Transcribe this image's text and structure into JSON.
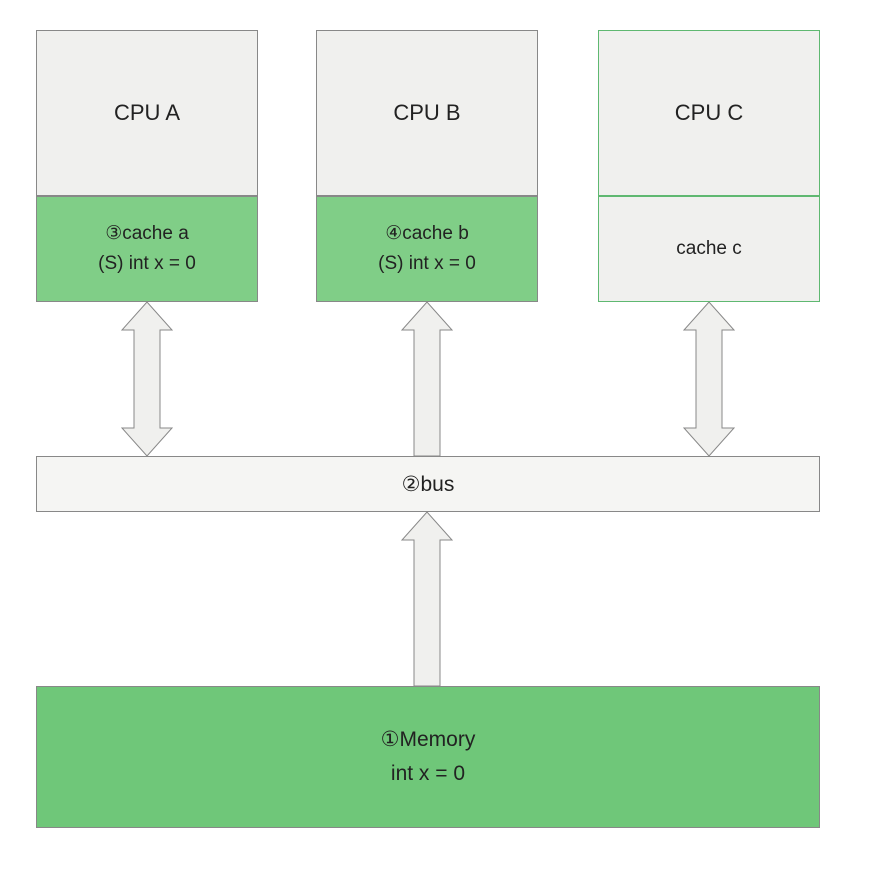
{
  "cpu_a": {
    "label": "CPU A"
  },
  "cpu_b": {
    "label": "CPU B"
  },
  "cpu_c": {
    "label": "CPU C"
  },
  "cache_a": {
    "title": "③cache a",
    "content": "(S) int x = 0"
  },
  "cache_b": {
    "title": "④cache b",
    "content": "(S)  int x = 0"
  },
  "cache_c": {
    "title": "cache c"
  },
  "bus": {
    "label": "②bus"
  },
  "memory": {
    "title": "①Memory",
    "content": "int x = 0"
  },
  "colors": {
    "green_fill": "#80ce87",
    "green_dark": "#6fc779",
    "grey_fill": "#f0f0ee",
    "arrow_fill": "#f0f0ee",
    "arrow_stroke": "#888"
  }
}
